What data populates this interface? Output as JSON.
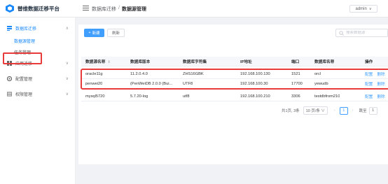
{
  "app": {
    "title": "替维数据迁移平台",
    "brand_color": "#1989fa"
  },
  "breadcrumb": {
    "parent": "数据库迁移",
    "separator": "/",
    "current": "数据源管理"
  },
  "user": {
    "name": "admin"
  },
  "sidebar": {
    "group": "数据库迁移",
    "items": [
      {
        "label": "数据源管理",
        "active": true
      },
      {
        "label": "任务管理",
        "active": false
      }
    ],
    "menus": [
      {
        "label": "应用迁移",
        "icon": "app-icon"
      },
      {
        "label": "配置管理",
        "icon": "gear-icon"
      },
      {
        "label": "权限管理",
        "icon": "permission-icon"
      }
    ]
  },
  "toolbar": {
    "new_label": "新建",
    "refresh_label": "刷新",
    "search_placeholder": "搜索数据源"
  },
  "table": {
    "columns": [
      "数据源名称",
      "数据库版本",
      "数据库字符集",
      "IP地址",
      "端口",
      "数据库名称",
      "操作"
    ],
    "rows": [
      {
        "name": "oracle11g",
        "version": "11.2.0.4.0",
        "charset": "ZHS16GBK",
        "ip": "192.168.100.130",
        "port": "1521",
        "db": "orcl"
      },
      {
        "name": "penwei20",
        "version": "(PenWeiDB 2.0.0 (Bui...",
        "charset": "UTF8",
        "ip": "192.168.100.30",
        "port": "17700",
        "db": "yewudb"
      },
      {
        "name": "mysql5720",
        "version": "5.7.20-log",
        "charset": "utf8",
        "ip": "192.168.100.210",
        "port": "3306",
        "db": "testdbfrom210"
      }
    ],
    "action_config": "配置",
    "action_delete": "删除"
  },
  "pagination": {
    "total_text": "共1页, 3条",
    "page_size": "10 页/条",
    "current_page": "1",
    "goto_label": "跳至",
    "goto_value": "1"
  }
}
